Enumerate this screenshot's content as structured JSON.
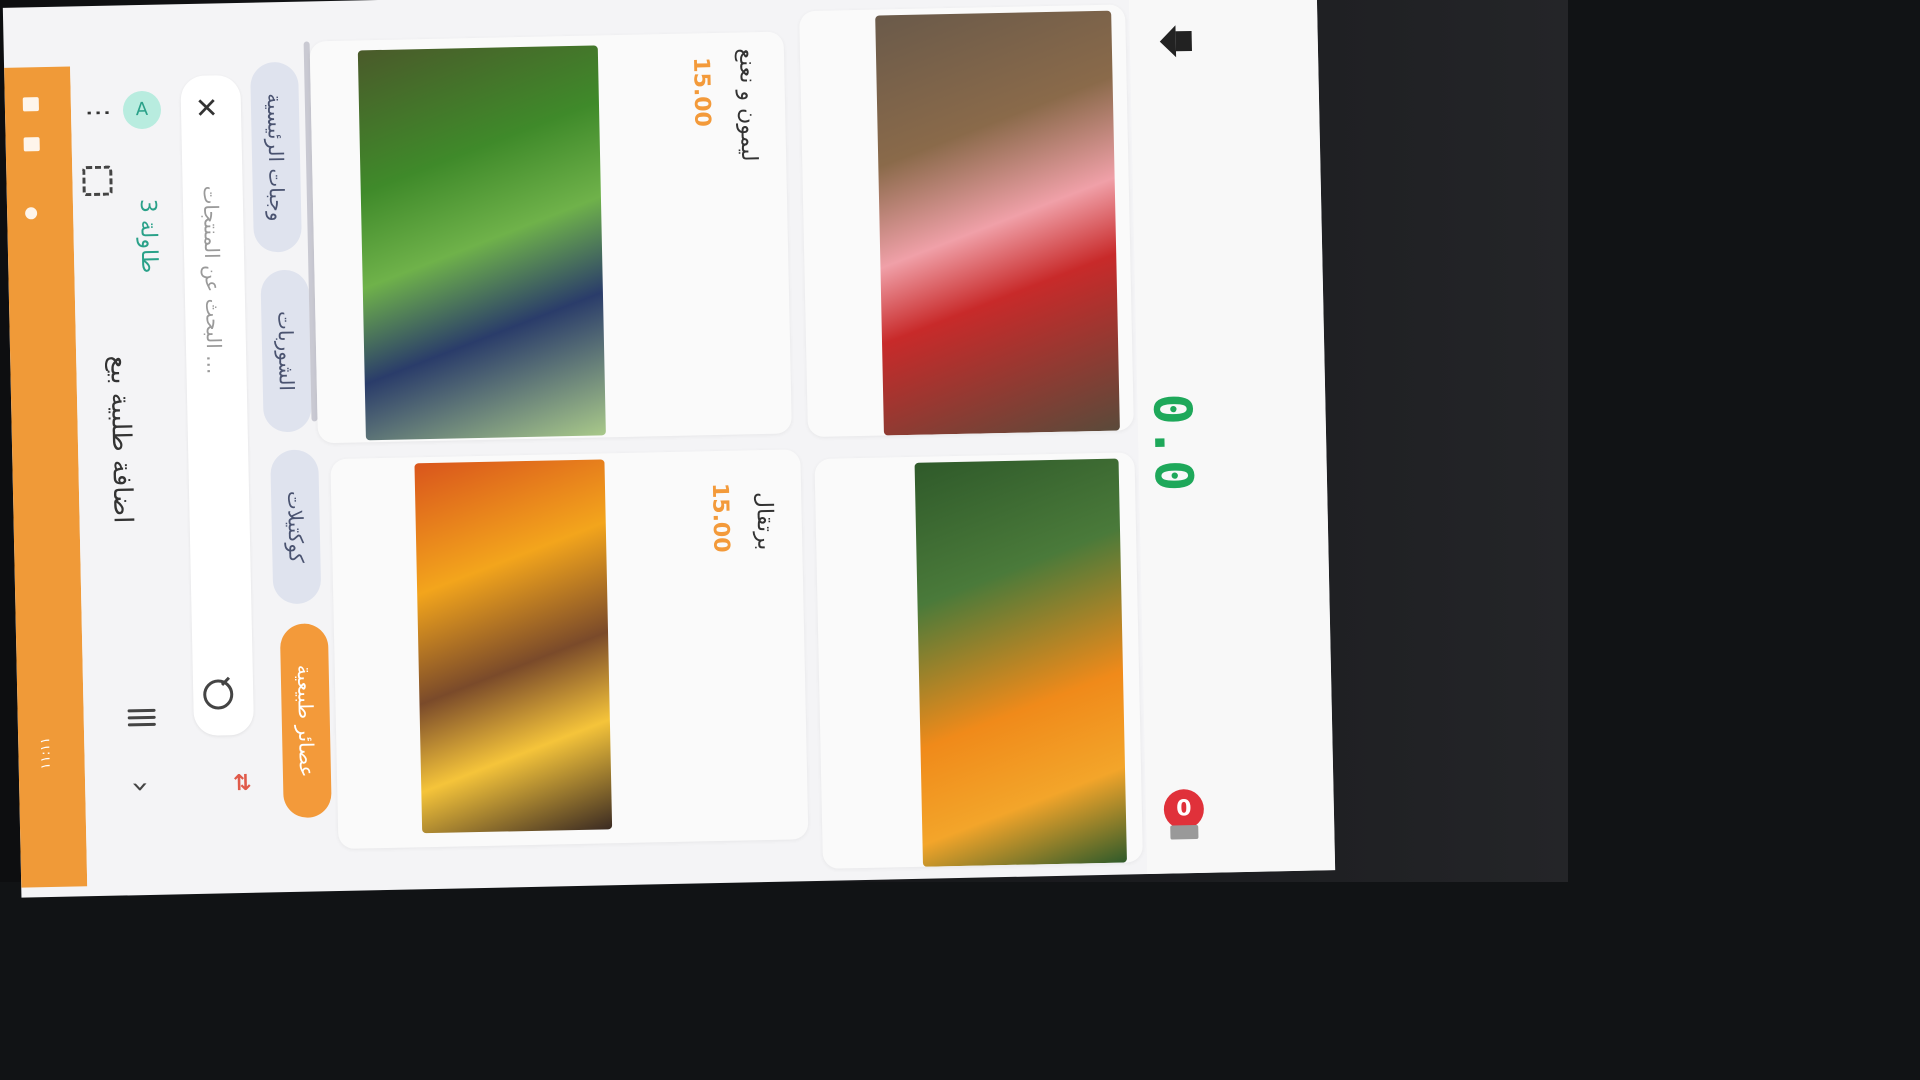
{
  "app": {
    "title": "اضافة طلبية بيع",
    "table_label": "طاولة 3",
    "avatar_letter": "A"
  },
  "status_bar": {
    "text": "۱۱:۱۱"
  },
  "search": {
    "placeholder": "البحث عن المنتجات ..."
  },
  "categories": [
    {
      "label": "عصائر طبيعية",
      "active": true
    },
    {
      "label": "كوكتيلات",
      "active": false
    },
    {
      "label": "الشوربات",
      "active": false
    },
    {
      "label": "وجبات الرئيسية",
      "active": false
    }
  ],
  "products": [
    {
      "name": "برتقال",
      "price": "15.00",
      "image": "orange-juice-photo"
    },
    {
      "name": "ليمون و نعنع",
      "price": "15.00",
      "image": "lemon-mint-juice-photo"
    },
    {
      "name": "",
      "price": "",
      "image": "carrot-juice-photo"
    },
    {
      "name": "",
      "price": "",
      "image": "strawberry-smoothie-photo"
    }
  ],
  "bottom": {
    "total_display": "0.0",
    "cart_count": "0"
  },
  "colors": {
    "accent": "#f39a3a",
    "brand_green": "#2aa189",
    "badge_red": "#e0313a"
  },
  "icons": [
    "back-arrow-icon",
    "hamburger-icon",
    "fullscreen-icon",
    "kebab-menu-icon",
    "search-icon",
    "close-icon",
    "sort-icon",
    "home-icon",
    "cart-icon"
  ]
}
